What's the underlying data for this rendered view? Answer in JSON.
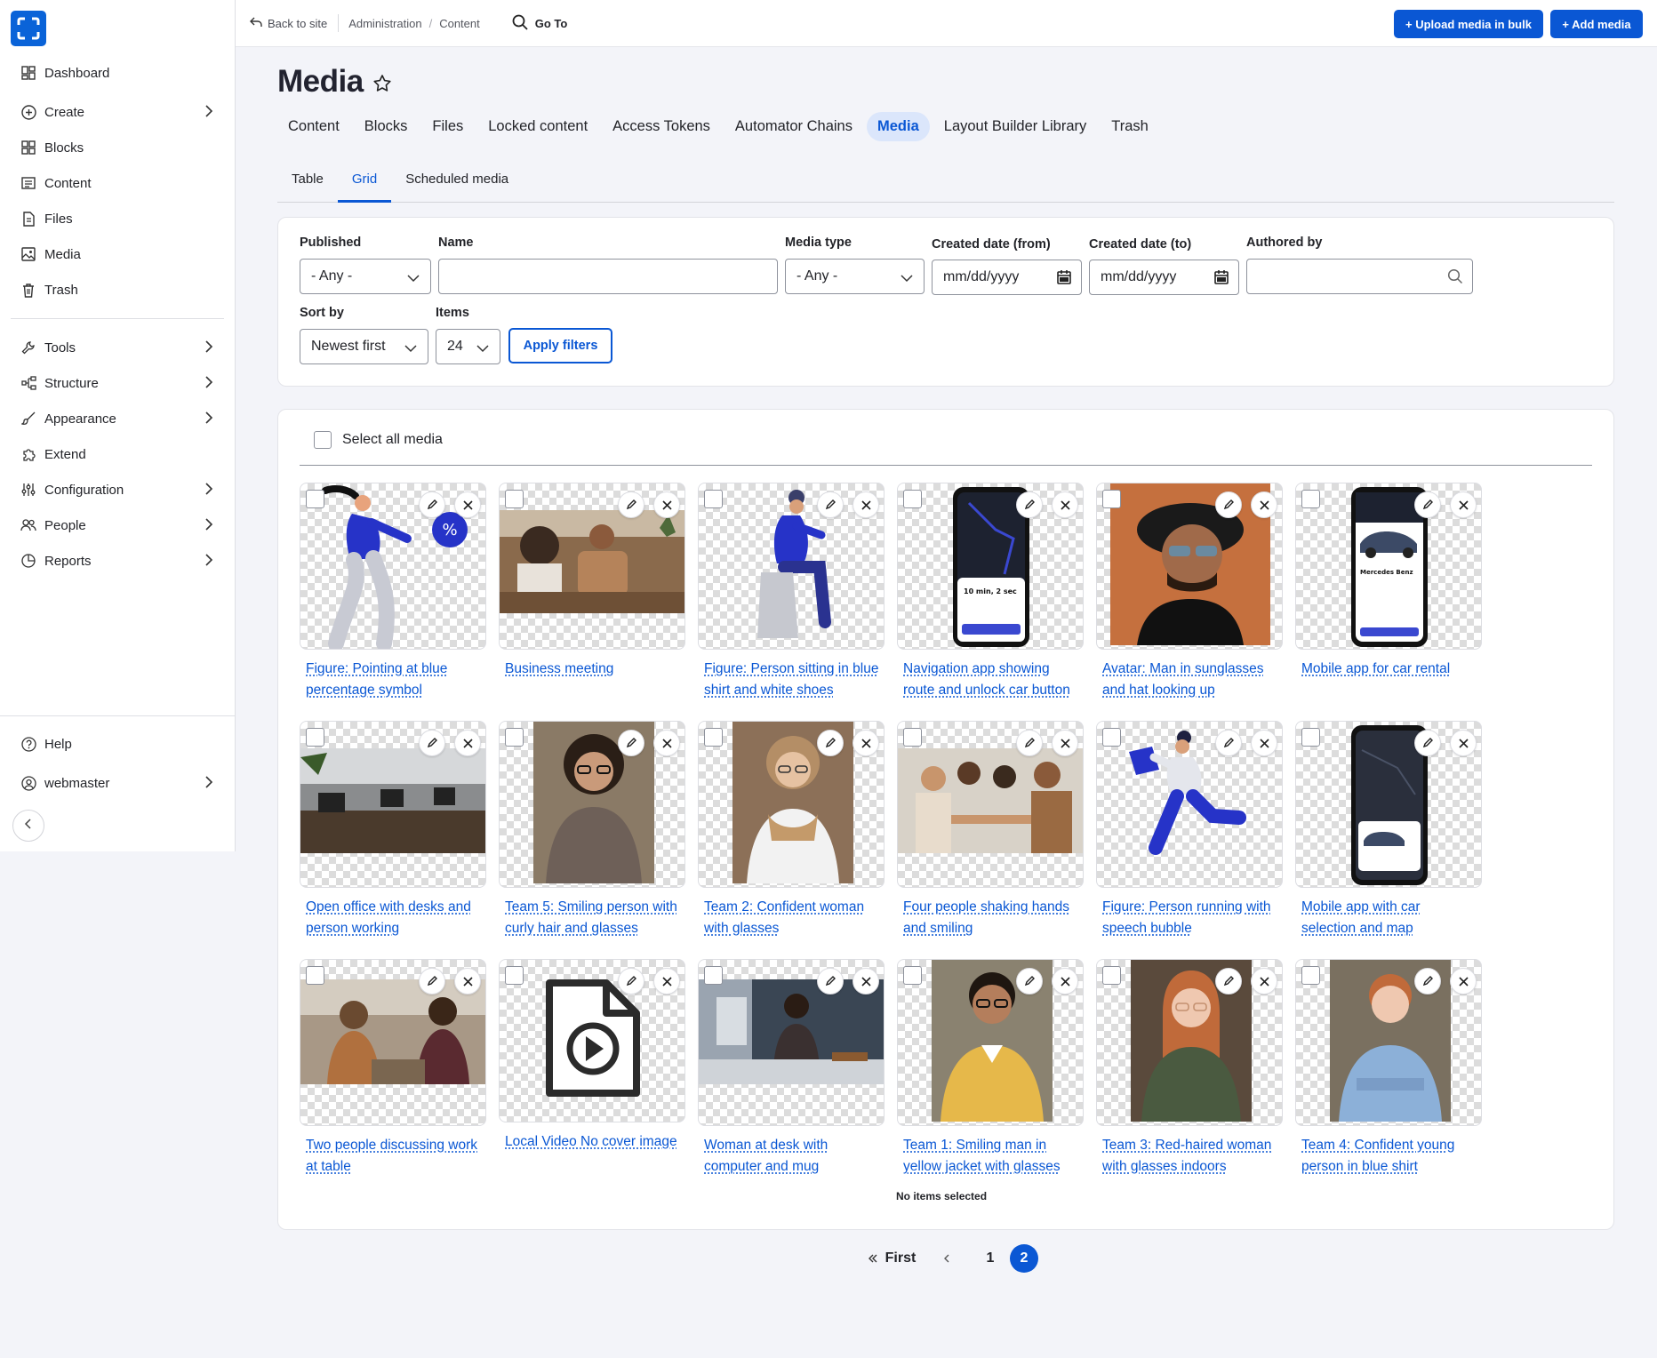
{
  "sidebar": {
    "items": [
      {
        "label": "Dashboard",
        "icon": "dashboard-icon"
      },
      {
        "label": "Create",
        "icon": "plus-circle-icon"
      },
      {
        "label": "Blocks",
        "icon": "blocks-icon"
      },
      {
        "label": "Content",
        "icon": "content-icon"
      },
      {
        "label": "Files",
        "icon": "files-icon"
      },
      {
        "label": "Media",
        "icon": "media-icon"
      },
      {
        "label": "Trash",
        "icon": "trash-icon"
      },
      {
        "label": "Tools",
        "icon": "wrench-icon"
      },
      {
        "label": "Structure",
        "icon": "structure-icon"
      },
      {
        "label": "Appearance",
        "icon": "brush-icon"
      },
      {
        "label": "Extend",
        "icon": "puzzle-icon"
      },
      {
        "label": "Configuration",
        "icon": "sliders-icon"
      },
      {
        "label": "People",
        "icon": "people-icon"
      },
      {
        "label": "Reports",
        "icon": "reports-icon"
      }
    ],
    "help": "Help",
    "user": "webmaster"
  },
  "topbar": {
    "back": "Back to site",
    "crumbs": [
      "Administration",
      "Content"
    ],
    "goto": "Go To",
    "upload_bulk": "+ Upload media in bulk",
    "add_media": "+ Add media"
  },
  "page": {
    "title": "Media",
    "primary_tabs": [
      "Content",
      "Blocks",
      "Files",
      "Locked content",
      "Access Tokens",
      "Automator Chains",
      "Media",
      "Layout Builder Library",
      "Trash"
    ],
    "secondary_tabs": [
      "Table",
      "Grid",
      "Scheduled media"
    ]
  },
  "filters": {
    "published_label": "Published",
    "published_value": "- Any -",
    "name_label": "Name",
    "name_value": "",
    "media_type_label": "Media type",
    "media_type_value": "- Any -",
    "created_from_label": "Created date (from)",
    "created_from_value": "mm/dd/yyyy",
    "created_to_label": "Created date (to)",
    "created_to_value": "mm/dd/yyyy",
    "authored_by_label": "Authored by",
    "authored_by_value": "",
    "sort_by_label": "Sort by",
    "sort_by_value": "Newest first",
    "items_label": "Items",
    "items_value": "24",
    "apply": "Apply filters"
  },
  "grid": {
    "select_all": "Select all media",
    "status": "No items selected",
    "items": [
      "Figure: Pointing at blue percentage symbol",
      "Business meeting",
      "Figure: Person sitting in blue shirt and white shoes",
      "Navigation app showing route and unlock car button",
      "Avatar: Man in sunglasses and hat looking up",
      "Mobile app for car rental",
      "Open office with desks and person working",
      "Team 5: Smiling person with curly hair and glasses",
      "Team 2: Confident woman with glasses",
      "Four people shaking hands and smiling",
      "Figure: Person running with speech bubble",
      "Mobile app with car selection and map",
      "Two people discussing work at table",
      "Local Video No cover image",
      "Woman at desk with computer and mug",
      "Team 1: Smiling man in yellow jacket with glasses",
      "Team 3: Red-haired woman with glasses indoors",
      "Team 4: Confident young person in blue shirt"
    ]
  },
  "pager": {
    "first": "First",
    "pages": [
      "1",
      "2"
    ],
    "current": "2"
  },
  "colors": {
    "accent": "#0a57d4",
    "logo": "#0a63d8"
  }
}
